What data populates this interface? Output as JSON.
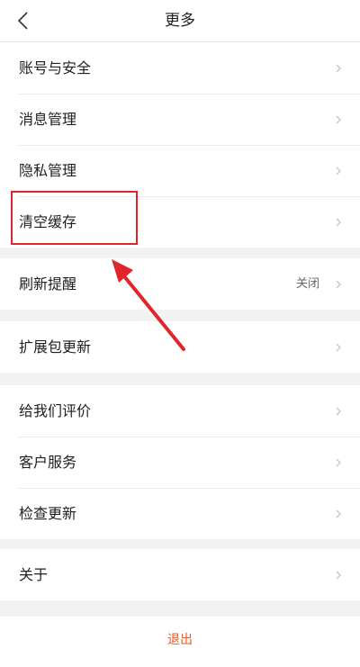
{
  "header": {
    "title": "更多",
    "back_icon": "chevron-left-icon"
  },
  "groups": [
    {
      "items": [
        {
          "label": "账号与安全"
        },
        {
          "label": "消息管理"
        },
        {
          "label": "隐私管理"
        },
        {
          "label": "清空缓存"
        }
      ]
    },
    {
      "items": [
        {
          "label": "刷新提醒",
          "value": "关闭"
        }
      ]
    },
    {
      "items": [
        {
          "label": "扩展包更新"
        }
      ]
    },
    {
      "items": [
        {
          "label": "给我们评价"
        },
        {
          "label": "客户服务"
        },
        {
          "label": "检查更新"
        }
      ]
    },
    {
      "items": [
        {
          "label": "关于"
        }
      ]
    }
  ],
  "logout_label": "退出",
  "colors": {
    "accent": "#e35d2a",
    "annotation": "#e0262b",
    "background": "#f2f2f2"
  }
}
